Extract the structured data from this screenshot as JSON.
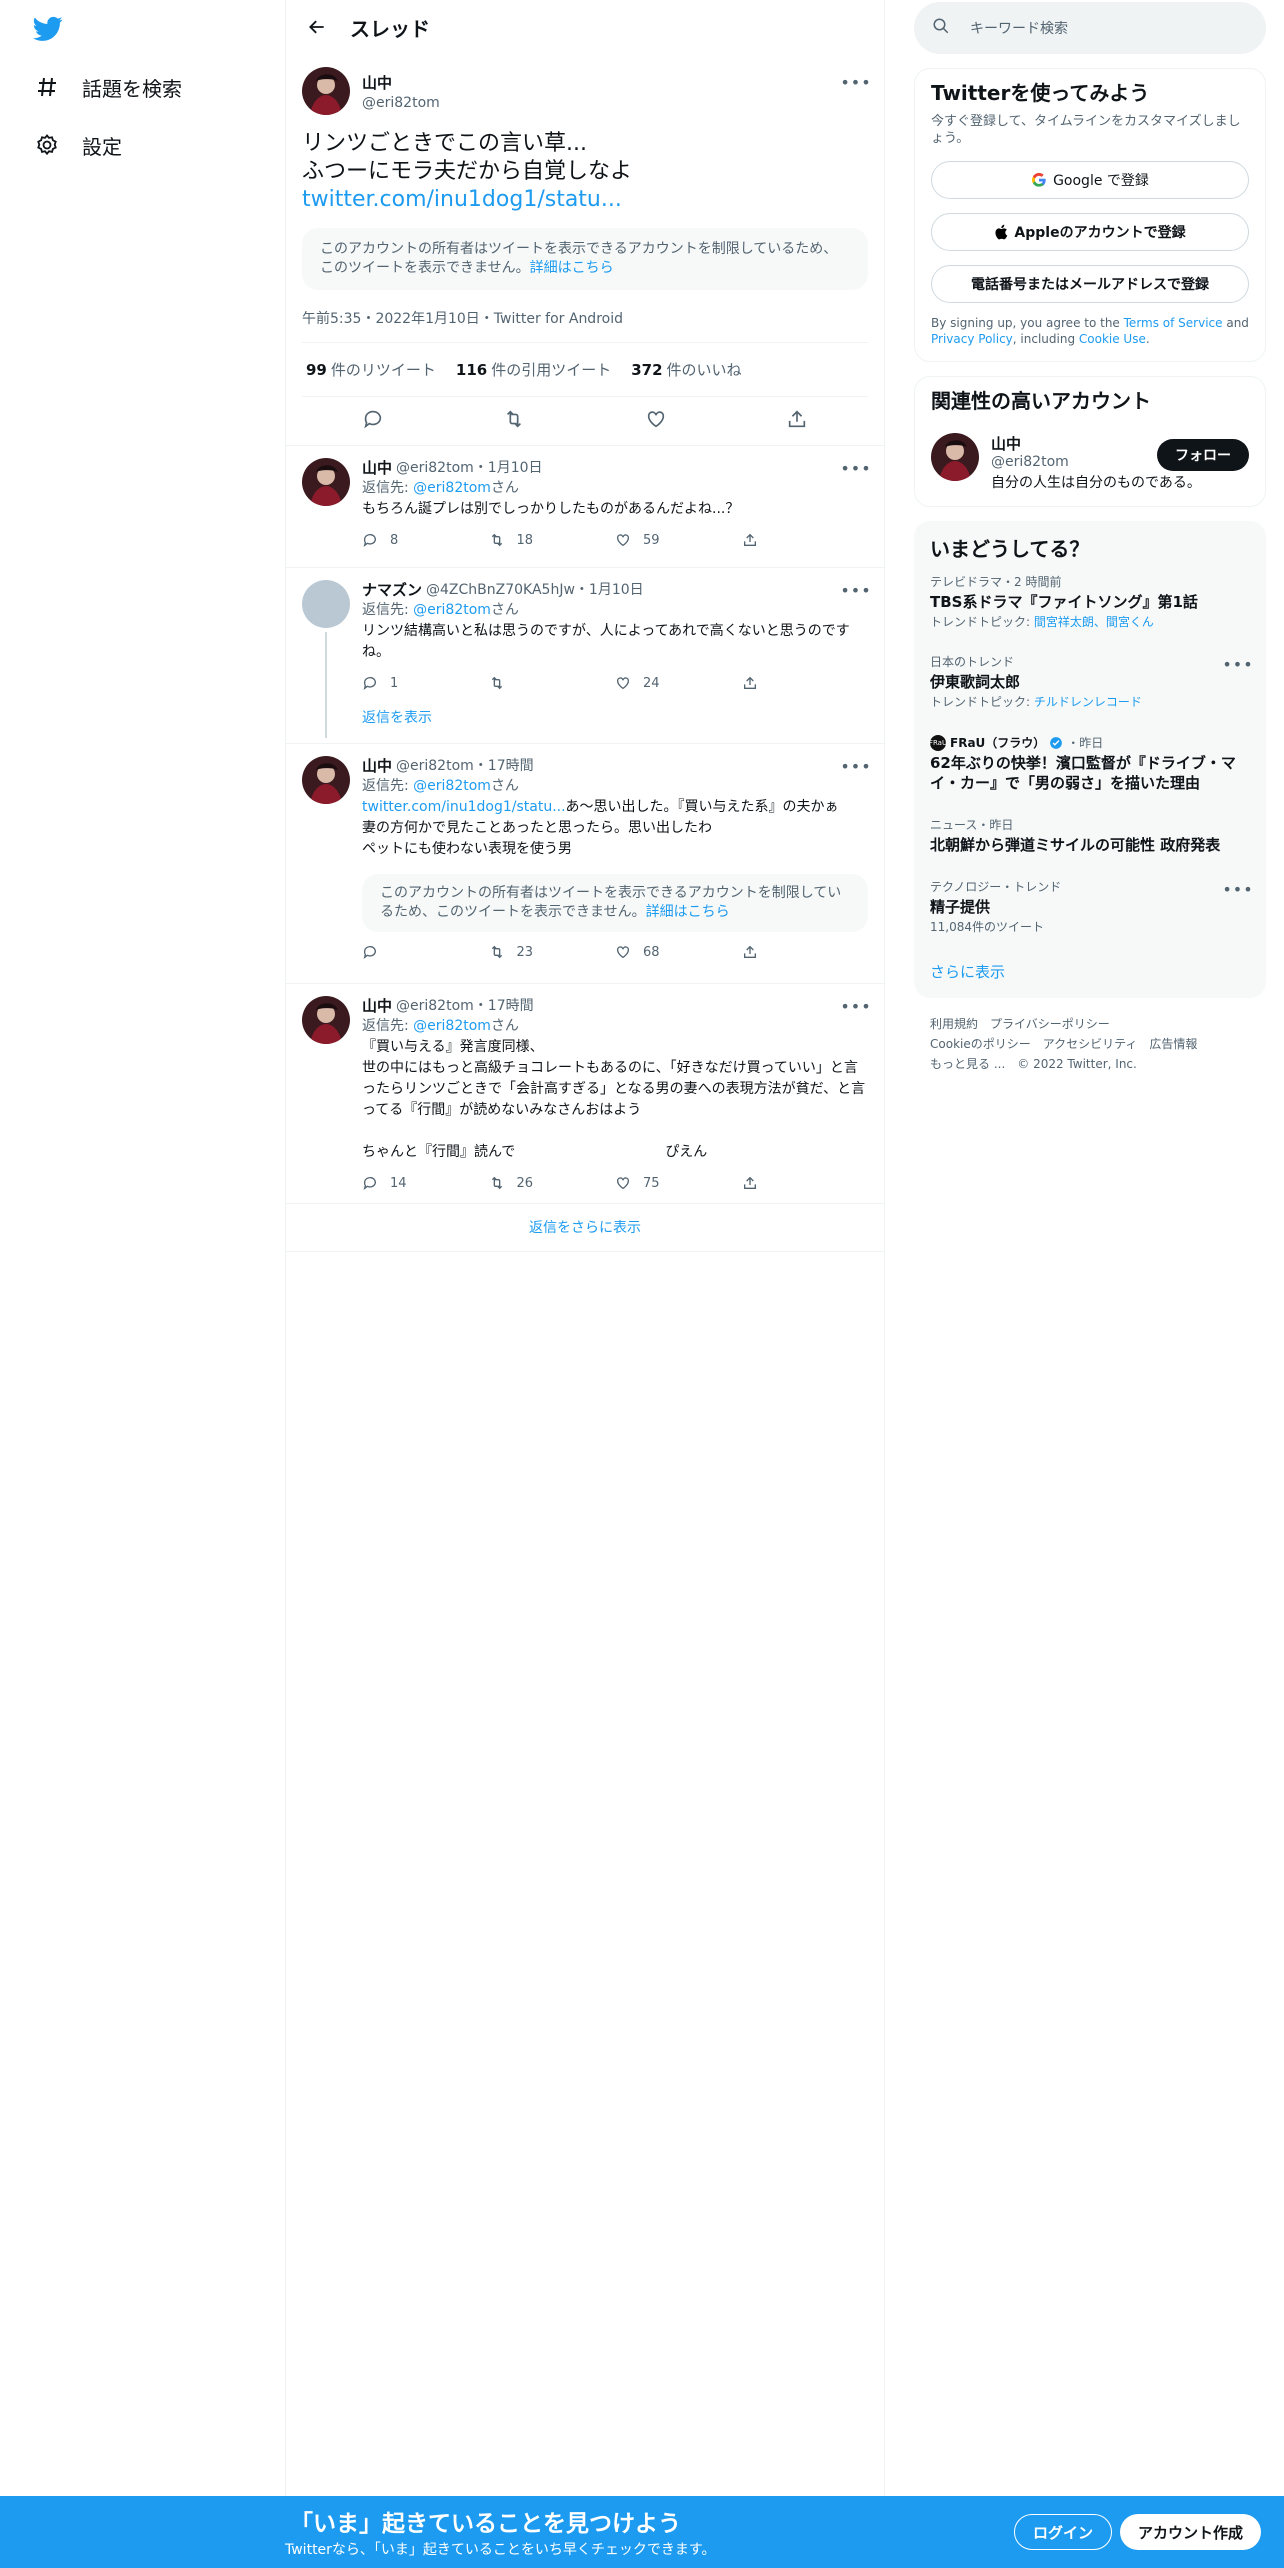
{
  "nav": {
    "explore": "話題を検索",
    "settings": "設定"
  },
  "header": {
    "title": "スレッド"
  },
  "focal": {
    "name": "山中",
    "handle": "@eri82tom",
    "text_line1": "リンツごときでこの言い草...",
    "text_line2": "ふつーにモラ夫だから自覚しなよ",
    "link": "twitter.com/inu1dog1/statu...",
    "restricted_text": "このアカウントの所有者はツイートを表示できるアカウントを制限しているため、このツイートを表示できません。",
    "restricted_link": "詳細はこちら",
    "meta": "午前5:35・2022年1月10日・Twitter for Android",
    "retweets": "99",
    "retweets_label": "件のリツイート",
    "quotes": "116",
    "quotes_label": "件の引用ツイート",
    "likes": "372",
    "likes_label": "件のいいね"
  },
  "replies": [
    {
      "name": "山中",
      "rest": "@eri82tom・1月10日",
      "reply_prefix": "返信先: ",
      "reply_to": "@eri82tom",
      "reply_suffix": "さん",
      "text": "もちろん誕プレは別でしっかりしたものがあるんだよね...？",
      "replies": "8",
      "retweets": "18",
      "likes": "59"
    },
    {
      "name": "ナマズン",
      "rest": "@4ZChBnZ70KA5hJw・1月10日",
      "reply_prefix": "返信先: ",
      "reply_to": "@eri82tom",
      "reply_suffix": "さん",
      "text": "リンツ結構高いと私は思うのですが、人によってあれで高くないと思うのですね。",
      "replies": "1",
      "retweets": "",
      "likes": "24",
      "show_replies": "返信を表示"
    },
    {
      "name": "山中",
      "rest": "@eri82tom・17時間",
      "reply_prefix": "返信先: ",
      "reply_to": "@eri82tom",
      "reply_suffix": "さん",
      "link": "twitter.com/inu1dog1/statu...",
      "text_after_link": "あ〜思い出した。『買い与えた系』の夫かぁ",
      "text_line2": "妻の方何かで見たことあったと思ったら。思い出したわ",
      "text_line3": "ペットにも使わない表現を使う男",
      "quote_text": "このアカウントの所有者はツイートを表示できるアカウントを制限しているため、このツイートを表示できません。",
      "quote_link": "詳細はこちら",
      "replies": "",
      "retweets": "23",
      "likes": "68"
    },
    {
      "name": "山中",
      "rest": "@eri82tom・17時間",
      "reply_prefix": "返信先: ",
      "reply_to": "@eri82tom",
      "reply_suffix": "さん",
      "text_line1": "『買い与える』発言度同様、",
      "text_line2": "世の中にはもっと高級チョコレートもあるのに、「好きなだけ買っていい」と言ったらリンツごときで「会計高すぎる」となる男の妻への表現方法が貧だ、と言ってる『行間』が読めないみなさんおはよう",
      "text_line3a": "ちゃんと『行間』読んで",
      "text_line3b": "ぴえん",
      "replies": "14",
      "retweets": "26",
      "likes": "75"
    }
  ],
  "more_replies": "返信をさらに表示",
  "right": {
    "search_placeholder": "キーワード検索",
    "signup": {
      "title": "Twitterを使ってみよう",
      "sub": "今すぐ登録して、タイムラインをカスタマイズしましょう。",
      "google": "Google で登録",
      "apple": "Appleのアカウントで登録",
      "phone": "電話番号またはメールアドレスで登録",
      "legal_1": "By signing up, you agree to the ",
      "tos": "Terms of Service",
      "legal_2": " and ",
      "privacy": "Privacy Policy",
      "legal_3": ", including ",
      "cookie": "Cookie Use",
      "legal_4": "."
    },
    "related": {
      "title": "関連性の高いアカウント",
      "name": "山中",
      "handle": "@eri82tom",
      "follow": "フォロー",
      "bio": "自分の人生は自分のものである。"
    },
    "trends": {
      "title": "いまどうしてる？",
      "items": [
        {
          "cat": "テレビドラマ・2 時間前",
          "title": "TBS系ドラマ『ファイトソング』第1話",
          "topic_prefix": "トレンドトピック: ",
          "topic": "間宮祥太朗、間宮くん"
        },
        {
          "cat": "日本のトレンド",
          "title": "伊東歌詞太郎",
          "topic_prefix": "トレンドトピック: ",
          "topic": "チルドレンレコード"
        },
        {
          "source": "FRaU（フラウ）",
          "source_abbr": "FRaU",
          "time": "・昨日",
          "title": "62年ぶりの快挙！濱口監督が『ドライブ・マイ・カー』で「男の弱さ」を描いた理由"
        },
        {
          "cat": "ニュース・昨日",
          "title": "北朝鮮から弾道ミサイルの可能性 政府発表"
        },
        {
          "cat": "テクノロジー・トレンド",
          "title": "精子提供",
          "count": "11,084件のツイート"
        }
      ],
      "show_more": "さらに表示"
    },
    "footer": {
      "terms": "利用規約",
      "privacy": "プライバシーポリシー",
      "cookie": "Cookieのポリシー",
      "a11y": "アクセシビリティ",
      "ads": "広告情報",
      "more": "もっと見る ...",
      "copy": "© 2022 Twitter, Inc."
    }
  },
  "bottom": {
    "title": "「いま」起きていることを見つけよう",
    "sub": "Twitterなら、「いま」起きていることをいち早くチェックできます。",
    "login": "ログイン",
    "signup": "アカウント作成"
  },
  "colors": {
    "accent": "#1d9bf0",
    "text": "#0f1419",
    "muted": "#536471"
  }
}
